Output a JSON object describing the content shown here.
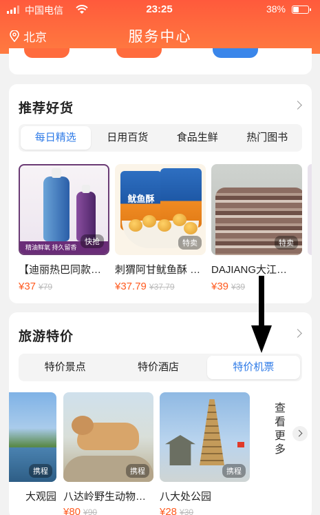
{
  "status_bar": {
    "carrier": "中国电信",
    "time": "23:25",
    "battery": "38%",
    "battery_level": 0.38
  },
  "header": {
    "city": "北京",
    "title": "服务中心"
  },
  "recommend": {
    "title": "推荐好货",
    "tabs": [
      "每日精选",
      "日用百货",
      "食品生鲜",
      "热门图书"
    ],
    "active_tab": 0,
    "products": [
      {
        "name": "【迪丽热巴同款…",
        "price": "¥37",
        "old_price": "¥79",
        "tag": "快抢",
        "banner": "精油鲜氧 持久留香"
      },
      {
        "name": "刺猬阿甘鱿鱼酥 …",
        "price": "¥37.79",
        "old_price": "¥37.79",
        "tag": "特卖",
        "bag_label": "鱿鱼酥"
      },
      {
        "name": "DAJIANG大江…",
        "price": "¥39",
        "old_price": "¥39",
        "tag": "特卖"
      }
    ]
  },
  "travel": {
    "title": "旅游特价",
    "tabs": [
      "特价景点",
      "特价酒店",
      "特价机票"
    ],
    "active_tab": 2,
    "destinations": [
      {
        "name": "大观园",
        "price": "",
        "old_price": "",
        "tag": "携程"
      },
      {
        "name": "八达岭野生动物…",
        "price": "¥80",
        "old_price": "¥90",
        "tag": "携程"
      },
      {
        "name": "八大处公园",
        "price": "¥28",
        "old_price": "¥30",
        "tag": "携程"
      }
    ],
    "more_label": "查看更多"
  },
  "colors": {
    "header": "#ff6a3d",
    "accent_blue": "#2f7be7",
    "price": "#ff5a1f"
  },
  "icons": [
    "signal-icon",
    "wifi-icon",
    "battery-icon",
    "location-pin-icon",
    "chevron-right-icon",
    "down-arrow-annotation"
  ]
}
